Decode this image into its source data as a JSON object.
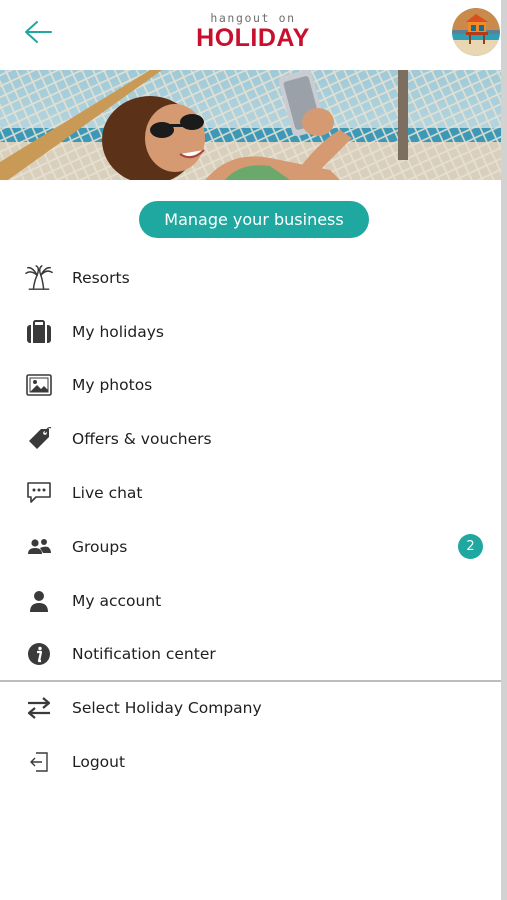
{
  "colors": {
    "accent": "#1fa89f",
    "brand_red": "#c8102e",
    "icon": "#3a3a3a"
  },
  "header": {
    "back_icon": "arrow-left-icon",
    "logo_top": "hangout on",
    "logo_main": "HOLIDAY",
    "avatar_icon": "beach-hut-avatar"
  },
  "banner": {
    "image": "woman-in-hammock-with-phone"
  },
  "manage_button": {
    "label": "Manage your business"
  },
  "menu": {
    "items": [
      {
        "label": "Resorts",
        "icon": "palm-trees-icon"
      },
      {
        "label": "My holidays",
        "icon": "suitcase-icon"
      },
      {
        "label": "My photos",
        "icon": "picture-icon"
      },
      {
        "label": "Offers & vouchers",
        "icon": "tag-icon"
      },
      {
        "label": "Live chat",
        "icon": "chat-bubble-icon"
      },
      {
        "label": "Groups",
        "icon": "people-icon",
        "badge": "2"
      },
      {
        "label": "My account",
        "icon": "person-icon"
      },
      {
        "label": "Notification center",
        "icon": "info-icon"
      }
    ],
    "secondary": [
      {
        "label": "Select Holiday Company",
        "icon": "swap-arrows-icon"
      },
      {
        "label": "Logout",
        "icon": "logout-icon"
      }
    ]
  }
}
